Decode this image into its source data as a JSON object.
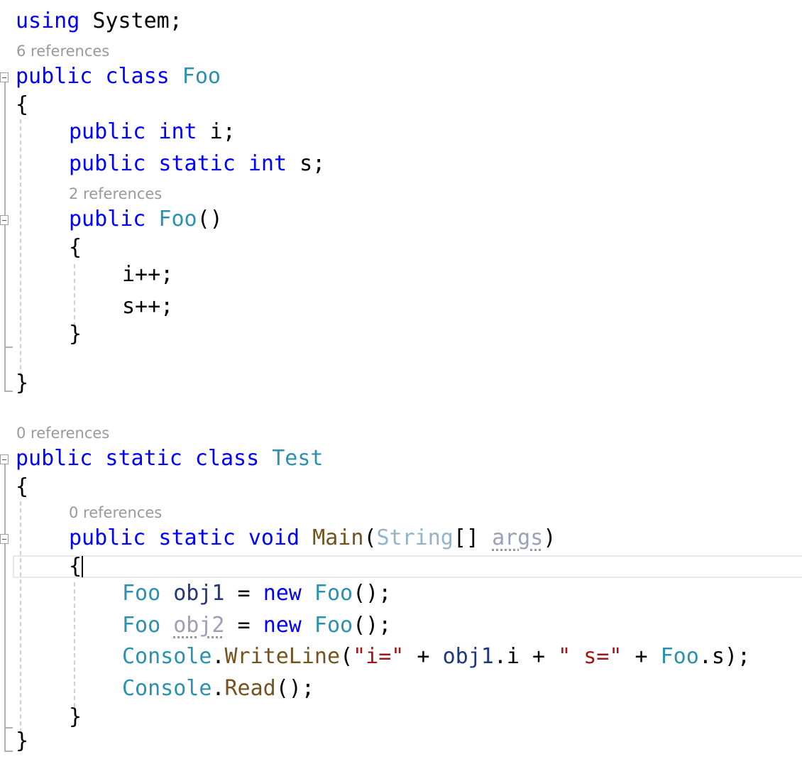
{
  "editor": {
    "language": "C#",
    "colors": {
      "keyword": "#0000ff",
      "type": "#2b91af",
      "method": "#74531f",
      "string": "#a31515",
      "local": "#1f377f",
      "codelens": "#999999"
    },
    "codelens": {
      "foo_class": "6 references",
      "foo_ctor": "2 references",
      "test_class": "0 references",
      "main_method": "0 references"
    },
    "lines": {
      "using_kw": "using",
      "using_ns": " System;",
      "foo_decl": {
        "kw1": "public",
        "kw2": " class",
        "name": " Foo"
      },
      "open_brace": "{",
      "close_brace": "}",
      "field_i": {
        "kw1": "public",
        "kw2": " int",
        "rest": " i;"
      },
      "field_s": {
        "kw1": "public",
        "kw2": " static",
        "kw3": " int",
        "rest": " s;"
      },
      "ctor_decl": {
        "kw1": "public",
        "name": " Foo",
        "rest": "()"
      },
      "inc_i": "i++;",
      "inc_s": "s++;",
      "test_decl": {
        "kw1": "public",
        "kw2": " static",
        "kw3": " class",
        "name": " Test"
      },
      "main_decl": {
        "kw1": "public",
        "kw2": " static",
        "kw3": " void",
        "name": " Main",
        "p1": "(",
        "ptype": "String",
        "p2": "[] ",
        "pname": "args",
        "p3": ")"
      },
      "obj1": {
        "type": "Foo",
        "var": " obj1",
        "eq": " = ",
        "kw": "new",
        "ctor": " Foo",
        "rest": "();"
      },
      "obj2": {
        "type": "Foo",
        "var": "obj2",
        "eq": " = ",
        "kw": "new",
        "ctor": " Foo",
        "rest": "();"
      },
      "writeline": {
        "cls": "Console",
        "dot": ".",
        "fn": "WriteLine",
        "p1": "(",
        "s1": "\"i=\"",
        "plus1": " + ",
        "var": "obj1",
        "mem": ".i",
        "plus2": " + ",
        "s2": "\" s=\"",
        "plus3": " + ",
        "cls2": "Foo",
        "mem2": ".s",
        "end": ");"
      },
      "read": {
        "cls": "Console",
        "dot": ".",
        "fn": "Read",
        "end": "();"
      }
    }
  }
}
